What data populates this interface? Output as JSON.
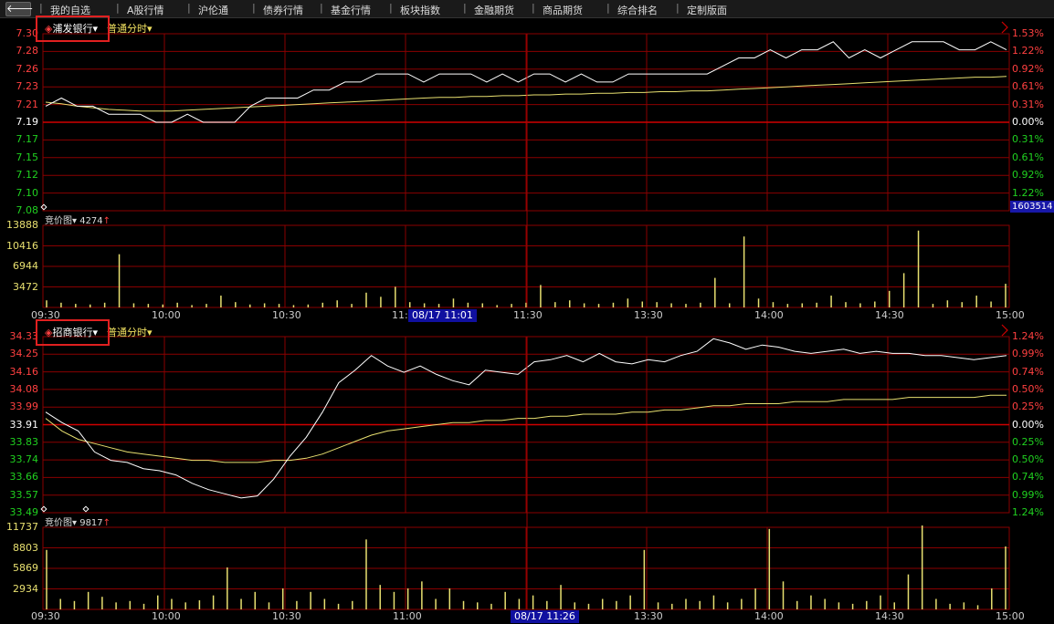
{
  "nav": {
    "back_label": "🡐",
    "items": [
      "我的自选",
      "A股行情",
      "沪伦通",
      "债券行情",
      "基金行情",
      "板块指数",
      "金融期货",
      "商品期货",
      "综合排名",
      "定制版面"
    ]
  },
  "panel1": {
    "stock_name": "浦发银行",
    "mode": "普通分时",
    "price_labels": [
      "7.30",
      "7.28",
      "7.26",
      "7.23",
      "7.21",
      "7.19",
      "7.17",
      "7.15",
      "7.12",
      "7.10",
      "7.08"
    ],
    "pct_labels": [
      "1.53%",
      "1.22%",
      "0.92%",
      "0.61%",
      "0.31%",
      "0.00%",
      "0.31%",
      "0.61%",
      "0.92%",
      "1.22%"
    ],
    "code_tag": "1603514",
    "vol_title": "竞价图",
    "vol_value": "4274",
    "vol_labels": [
      "13888",
      "10416",
      "6944",
      "3472"
    ],
    "time_labels": [
      "09:30",
      "10:00",
      "10:30",
      "11:",
      "11:30",
      "13:30",
      "14:00",
      "14:30",
      "15:00"
    ],
    "cursor_time": "08/17 11:01"
  },
  "panel2": {
    "stock_name": "招商银行",
    "mode": "普通分时",
    "price_labels": [
      "34.33",
      "34.25",
      "34.16",
      "34.08",
      "33.99",
      "33.91",
      "33.83",
      "33.74",
      "33.66",
      "33.57",
      "33.49"
    ],
    "pct_labels": [
      "1.24%",
      "0.99%",
      "0.74%",
      "0.50%",
      "0.25%",
      "0.00%",
      "0.25%",
      "0.50%",
      "0.74%",
      "0.99%",
      "1.24%"
    ],
    "vol_title": "竞价图",
    "vol_value": "9817",
    "vol_labels": [
      "11737",
      "8803",
      "5869",
      "2934"
    ],
    "time_labels": [
      "09:30",
      "10:00",
      "10:30",
      "11:00",
      "13:30",
      "14:00",
      "14:30",
      "15:00"
    ],
    "cursor_time": "08/17 11:26"
  },
  "colors": {
    "grid": "#8a0000",
    "price_line": "#ffffff",
    "avg_line": "#e8e070",
    "up": "#ff4040",
    "down": "#20d020",
    "neutral": "#ffffff",
    "volume": "#e8e070"
  },
  "chart_data": [
    {
      "type": "line",
      "series": [
        {
          "values": [
            7.21,
            7.22,
            7.21,
            7.21,
            7.2,
            7.2,
            7.2,
            7.19,
            7.19,
            7.2,
            7.19,
            7.19,
            7.19,
            7.21,
            7.22,
            7.22,
            7.22,
            7.23,
            7.23,
            7.24,
            7.24,
            7.25,
            7.25,
            7.25,
            7.24,
            7.25,
            7.25,
            7.25,
            7.24,
            7.25,
            7.24,
            7.25,
            7.25,
            7.24,
            7.25,
            7.24,
            7.24,
            7.25,
            7.25,
            7.25,
            7.25,
            7.25,
            7.25,
            7.26,
            7.27,
            7.27,
            7.28,
            7.27,
            7.28,
            7.28,
            7.29,
            7.27,
            7.28,
            7.27,
            7.28,
            7.29,
            7.29,
            7.29,
            7.28,
            7.28,
            7.29,
            7.28
          ]
        },
        {
          "values": [
            7.215,
            7.213,
            7.21,
            7.208,
            7.206,
            7.205,
            7.204,
            7.204,
            7.204,
            7.205,
            7.206,
            7.207,
            7.208,
            7.209,
            7.21,
            7.211,
            7.212,
            7.213,
            7.214,
            7.215,
            7.216,
            7.217,
            7.218,
            7.219,
            7.22,
            7.221,
            7.221,
            7.222,
            7.222,
            7.223,
            7.223,
            7.224,
            7.224,
            7.225,
            7.225,
            7.226,
            7.226,
            7.227,
            7.227,
            7.228,
            7.228,
            7.229,
            7.229,
            7.23,
            7.231,
            7.232,
            7.233,
            7.234,
            7.235,
            7.236,
            7.237,
            7.238,
            7.239,
            7.24,
            7.241,
            7.242,
            7.243,
            7.244,
            7.245,
            7.246,
            7.246,
            7.247
          ]
        }
      ],
      "ylim": [
        7.08,
        7.3
      ]
    },
    {
      "type": "bar",
      "values": [
        1200,
        800,
        600,
        500,
        800,
        9000,
        700,
        600,
        500,
        800,
        400,
        600,
        2000,
        900,
        500,
        700,
        600,
        400,
        500,
        800,
        1200,
        600,
        2500,
        1800,
        3500,
        900,
        700,
        600,
        1500,
        800,
        700,
        400,
        600,
        800,
        3800,
        900,
        1200,
        700,
        600,
        800,
        1500,
        1000,
        900,
        700,
        600,
        800,
        5000,
        700,
        12000,
        1500,
        900,
        600,
        700,
        800,
        2000,
        900,
        700,
        1000,
        2800,
        5800,
        13000,
        600,
        1200,
        900,
        2000,
        1000,
        4000
      ],
      "ylim": [
        0,
        13888
      ]
    },
    {
      "type": "line",
      "series": [
        {
          "values": [
            33.97,
            33.92,
            33.88,
            33.78,
            33.74,
            33.73,
            33.7,
            33.69,
            33.67,
            33.63,
            33.6,
            33.58,
            33.56,
            33.57,
            33.65,
            33.76,
            33.85,
            33.97,
            34.11,
            34.17,
            34.24,
            34.19,
            34.16,
            34.19,
            34.15,
            34.12,
            34.1,
            34.17,
            34.16,
            34.15,
            34.21,
            34.22,
            34.24,
            34.21,
            34.25,
            34.21,
            34.2,
            34.22,
            34.21,
            34.24,
            34.26,
            34.32,
            34.3,
            34.27,
            34.29,
            34.28,
            34.26,
            34.25,
            34.26,
            34.27,
            34.25,
            34.26,
            34.25,
            34.25,
            34.24,
            34.24,
            34.23,
            34.22,
            34.23,
            34.24
          ]
        },
        {
          "values": [
            33.94,
            33.88,
            33.84,
            33.82,
            33.8,
            33.78,
            33.77,
            33.76,
            33.75,
            33.74,
            33.74,
            33.73,
            33.73,
            33.73,
            33.74,
            33.74,
            33.75,
            33.77,
            33.8,
            33.83,
            33.86,
            33.88,
            33.89,
            33.9,
            33.91,
            33.92,
            33.92,
            33.93,
            33.93,
            33.94,
            33.94,
            33.95,
            33.95,
            33.96,
            33.96,
            33.96,
            33.97,
            33.97,
            33.98,
            33.98,
            33.99,
            34.0,
            34.0,
            34.01,
            34.01,
            34.01,
            34.02,
            34.02,
            34.02,
            34.03,
            34.03,
            34.03,
            34.03,
            34.04,
            34.04,
            34.04,
            34.04,
            34.04,
            34.05,
            34.05
          ]
        }
      ],
      "ylim": [
        33.49,
        34.33
      ]
    },
    {
      "type": "bar",
      "values": [
        8500,
        1500,
        1200,
        2500,
        1800,
        1000,
        1200,
        800,
        2000,
        1500,
        1000,
        1300,
        2000,
        6000,
        1500,
        2500,
        1000,
        3000,
        1200,
        2500,
        1500,
        800,
        1200,
        10000,
        3500,
        2500,
        3000,
        4000,
        1500,
        3000,
        1200,
        1000,
        800,
        2500,
        1500,
        2000,
        1200,
        3500,
        1000,
        800,
        1500,
        1200,
        2000,
        8500,
        1000,
        800,
        1500,
        1200,
        2000,
        1000,
        1500,
        3000,
        11500,
        4000,
        1200,
        2000,
        1500,
        1000,
        800,
        1200,
        2000,
        1000,
        5000,
        12000,
        1500,
        800,
        1000,
        600,
        3000,
        9000
      ],
      "ylim": [
        0,
        11737
      ]
    }
  ]
}
